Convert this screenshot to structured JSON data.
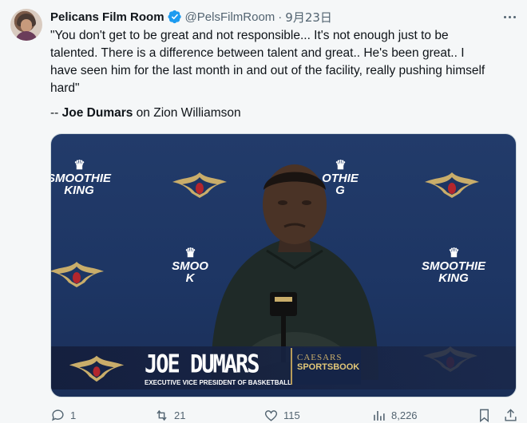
{
  "author": {
    "name": "Pelicans Film Room",
    "handle": "@PelsFilmRoom",
    "separator": "·",
    "date": "9月23日"
  },
  "tweet": {
    "text_lines": [
      "\"You don't get to be great and not responsible... It's not enough just to be",
      "talented. There is a difference between talent and great.. He's been great.. I",
      "have seen him for the last month in and out of the facility, really pushing himself",
      "hard\""
    ],
    "attribution_prefix": "-- ",
    "attribution_name": "Joe Dumars",
    "attribution_suffix": " on Zion Williamson"
  },
  "media": {
    "backdrop_sponsor_line1": "SMOOTHIE",
    "backdrop_sponsor_line2": "KING",
    "lower_third_name": "JOE DUMARS",
    "lower_third_title": "EXECUTIVE VICE PRESIDENT OF BASKETBALL OPERATIONS",
    "sponsor_line1": "CAESARS",
    "sponsor_line2": "SPORTSBOOK",
    "colors": {
      "backdrop": "#1d3563",
      "gold": "#c9ad6a",
      "red": "#b3262d"
    }
  },
  "actions": {
    "reply_count": "1",
    "retweet_count": "21",
    "like_count": "115",
    "view_count": "8,226"
  },
  "icons": [
    "verified-badge-icon",
    "more-icon",
    "reply-icon",
    "retweet-icon",
    "like-icon",
    "views-icon",
    "bookmark-icon",
    "share-icon"
  ],
  "colors": {
    "text": "#0f1419",
    "secondary": "#536471",
    "verified": "#1d9bf0",
    "background": "#f5f7f8"
  }
}
